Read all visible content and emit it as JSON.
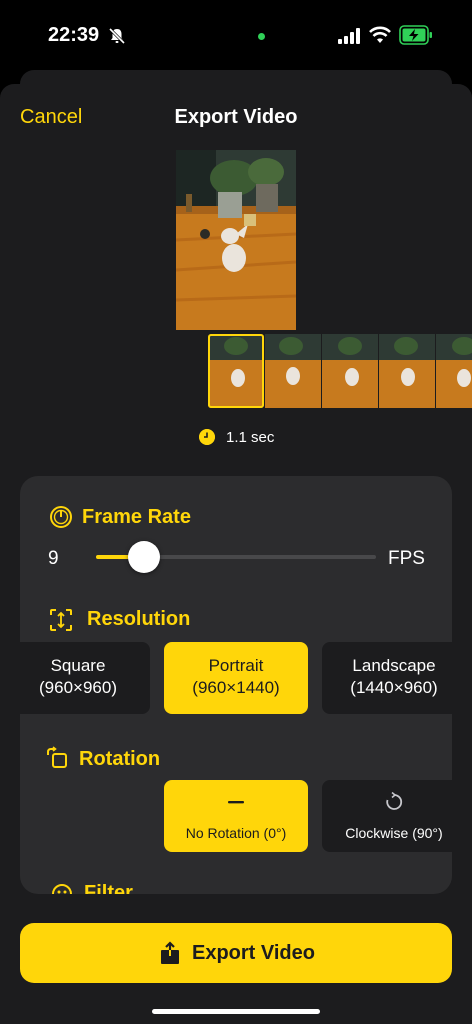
{
  "status": {
    "time": "22:39",
    "icons": [
      "bell-slash-icon",
      "camera-active-dot",
      "signal-icon",
      "wifi-icon",
      "battery-charging-icon"
    ]
  },
  "nav": {
    "cancel_label": "Cancel",
    "title": "Export Video"
  },
  "preview": {
    "duration": "1.1 sec",
    "frame_count_visible": 5,
    "selected_frame": 1
  },
  "frame_rate": {
    "title": "Frame Rate",
    "value": "9",
    "unit": "FPS",
    "slider_fraction": 0.17
  },
  "resolution": {
    "title": "Resolution",
    "options": [
      {
        "name": "Square",
        "size": "(960×960)",
        "selected": false
      },
      {
        "name": "Portrait",
        "size": "(960×1440)",
        "selected": true
      },
      {
        "name": "Landscape",
        "size": "(1440×960)",
        "selected": false
      }
    ]
  },
  "rotation": {
    "title": "Rotation",
    "options": [
      {
        "label": "No Rotation (0°)",
        "icon": "minus-icon",
        "selected": true
      },
      {
        "label": "Clockwise (90°)",
        "icon": "rotate-clockwise-icon",
        "selected": false
      }
    ]
  },
  "filter": {
    "title": "Filter"
  },
  "export": {
    "label": "Export Video",
    "icon": "share-icon"
  },
  "colors": {
    "accent": "#ffd60a",
    "background": "#1c1c1e",
    "card": "#2c2c2e"
  }
}
